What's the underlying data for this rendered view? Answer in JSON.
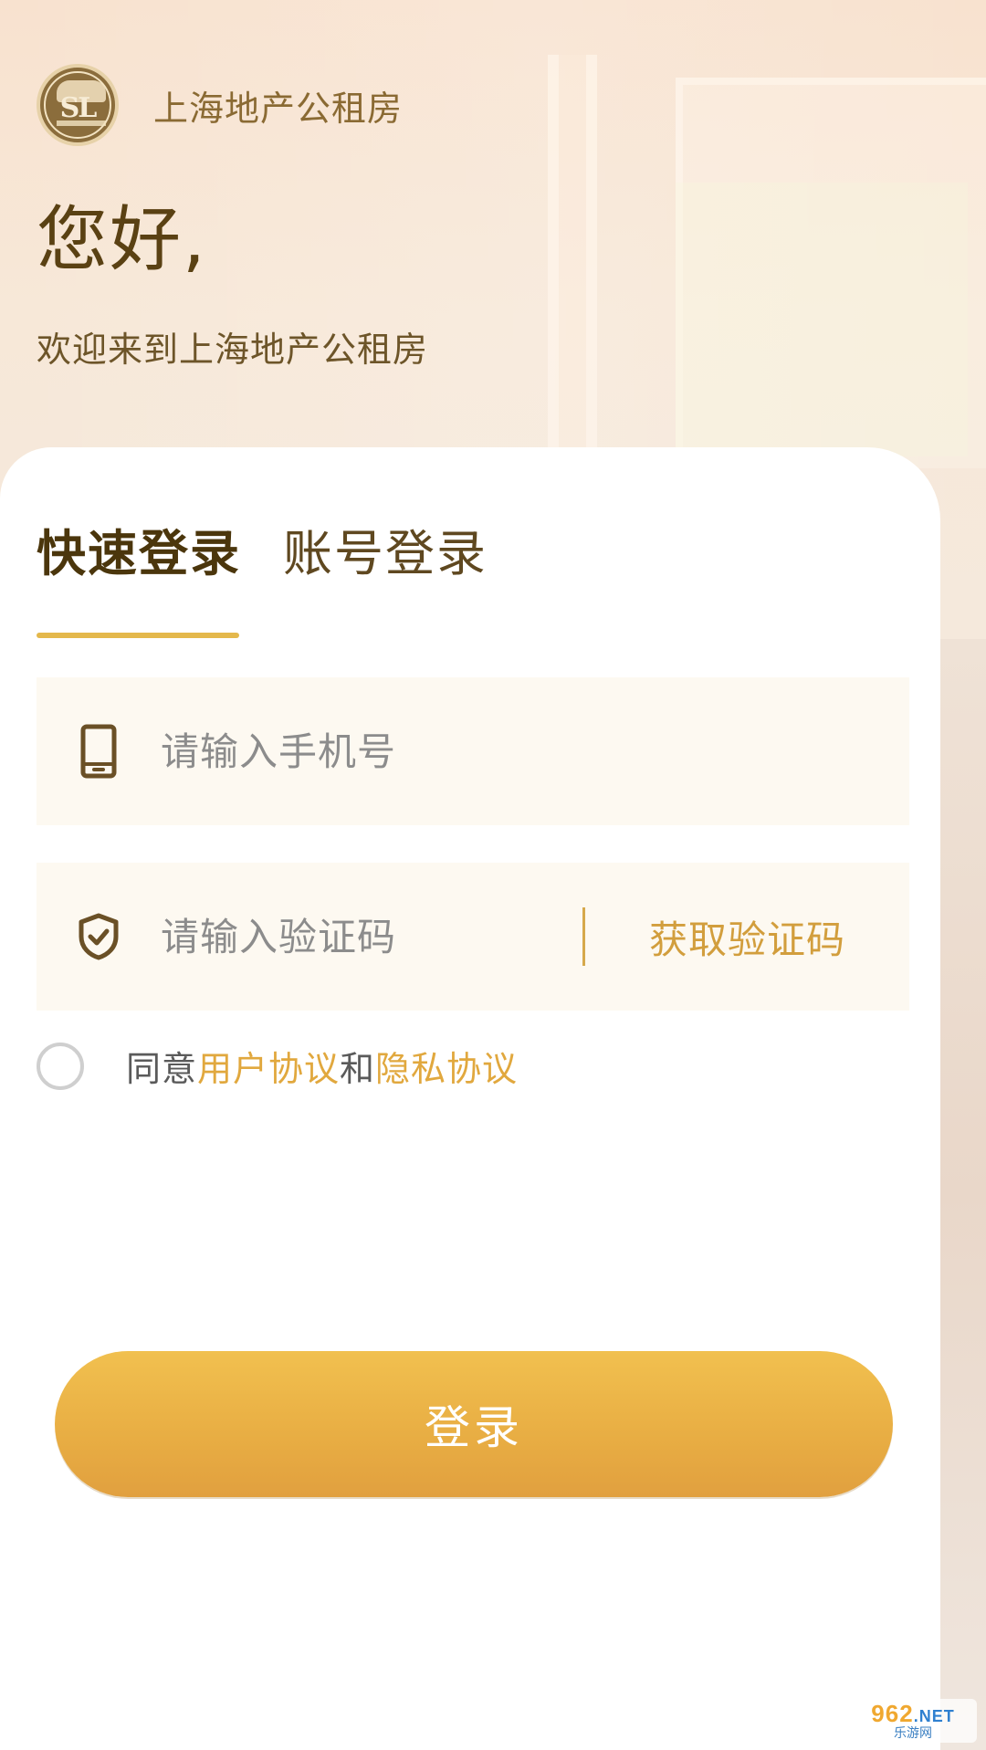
{
  "header": {
    "logo_text": "SL",
    "app_name": "上海地产公租房"
  },
  "greeting": {
    "title": "您好,",
    "subtitle": "欢迎来到上海地产公租房"
  },
  "tabs": [
    {
      "label": "快速登录",
      "active": true
    },
    {
      "label": "账号登录",
      "active": false
    }
  ],
  "form": {
    "phone_placeholder": "请输入手机号",
    "code_placeholder": "请输入验证码",
    "get_code_label": "获取验证码"
  },
  "agreement": {
    "prefix": "同意",
    "user_agreement": "用户协议",
    "conjunction": "和",
    "privacy_agreement": "隐私协议",
    "checked": false
  },
  "login_button": {
    "label": "登录"
  },
  "watermark": {
    "top": "962",
    "net": ".NET",
    "bottom": "乐游网"
  },
  "colors": {
    "accent": "#e4b84c",
    "link": "#e1a83e",
    "button_top": "#f1c04f",
    "button_bottom": "#e1a03f",
    "heading": "#4b360c"
  },
  "icons": {
    "phone": "phone-icon",
    "verify": "shield-check-icon",
    "logo": "company-logo-icon"
  }
}
